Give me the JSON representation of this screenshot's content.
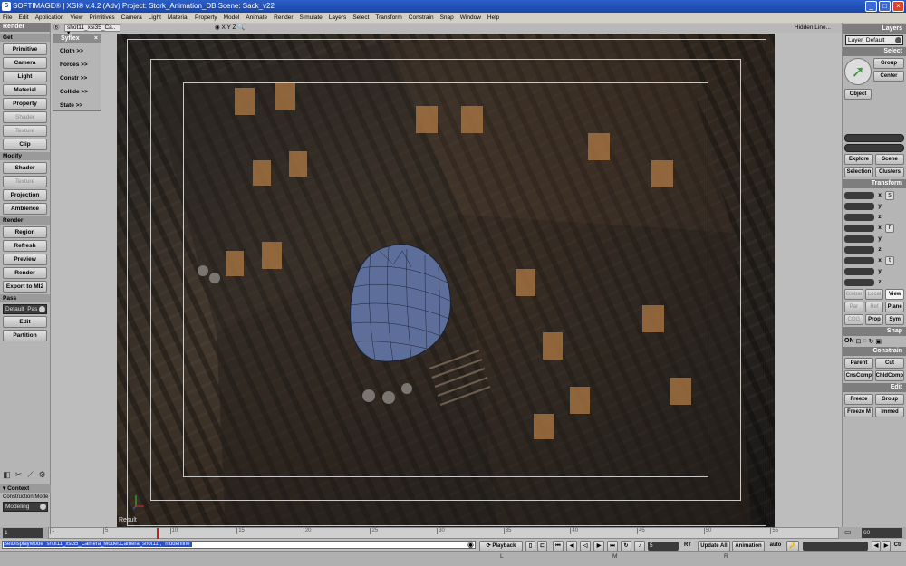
{
  "window": {
    "title": "SOFTIMAGE® | XSI® v.4.2 (Adv) Project: Stork_Animation_DB    Scene: Sack_v22",
    "app_icon": "xsi-icon"
  },
  "menu": [
    "File",
    "Edit",
    "Application",
    "View",
    "Primitives",
    "Camera",
    "Light",
    "Material",
    "Property",
    "Model",
    "Animate",
    "Render",
    "Simulate",
    "Layers",
    "Select",
    "Transform",
    "Constrain",
    "Snap",
    "Window",
    "Help"
  ],
  "left": {
    "header": "Render",
    "get_label": "Get",
    "get": [
      {
        "label": "Primitive",
        "enabled": true
      },
      {
        "label": "Camera",
        "enabled": true
      },
      {
        "label": "Light",
        "enabled": true
      },
      {
        "label": "Material",
        "enabled": true
      },
      {
        "label": "Property",
        "enabled": true
      },
      {
        "label": "Shader",
        "enabled": false
      },
      {
        "label": "Texture",
        "enabled": false
      },
      {
        "label": "Clip",
        "enabled": true
      }
    ],
    "modify_label": "Modify",
    "modify": [
      {
        "label": "Shader",
        "enabled": true
      },
      {
        "label": "Texture",
        "enabled": false
      },
      {
        "label": "Projection",
        "enabled": true
      },
      {
        "label": "Ambience",
        "enabled": true
      }
    ],
    "render_label": "Render",
    "render": [
      "Region",
      "Refresh",
      "Preview",
      "Render",
      "Export to MI2"
    ],
    "pass_label": "Pass",
    "pass_value": "Default_Pas",
    "pass_buttons": [
      "Edit",
      "Partition"
    ],
    "context_label": "Context",
    "construction_label": "Construction Mode",
    "construction_value": "Modeling"
  },
  "syflex": {
    "title": "Syflex",
    "items": [
      "Cloth  >>",
      "Forces  >>",
      "Constr  >>",
      "Collide  >>",
      "State  >>"
    ]
  },
  "viewport": {
    "camera_name": "shot11_xsi35_Ca..",
    "view_icons": "◉  X Y Z  🔍",
    "display_mode": "Hidden Line...",
    "label": "Result"
  },
  "right": {
    "layers_header": "Layers",
    "layer_value": "Layer_Default",
    "select_header": "Select",
    "select_buttons": [
      "Group",
      "Center"
    ],
    "object_label": "Object",
    "explore_buttons": [
      "Explore",
      "Scene"
    ],
    "selection_buttons": [
      "Selection",
      "Clusters"
    ],
    "transform_header": "Transform",
    "axes": [
      "x",
      "y",
      "z",
      "x",
      "y",
      "z",
      "x",
      "y",
      "z"
    ],
    "transform_icons": [
      "s",
      "r",
      "t"
    ],
    "space_buttons": [
      "Global",
      "Local",
      "View"
    ],
    "ref_buttons": [
      "Par",
      "Ref",
      "Plane"
    ],
    "cog_buttons": [
      "COG",
      "Prop",
      "Sym"
    ],
    "snap_header": "Snap",
    "snap_on": "ON",
    "constrain_header": "Constrain",
    "constrain_buttons": [
      "Parent",
      "Cut",
      "CnsComp",
      "ChldComp"
    ],
    "edit_header": "Edit",
    "edit_buttons": [
      "Freeze",
      "Group",
      "Freeze M",
      "Immed"
    ]
  },
  "timeline": {
    "start": "1",
    "end": "60",
    "ticks": [
      "1",
      "5",
      "10",
      "15",
      "20",
      "25",
      "30",
      "35",
      "40",
      "45",
      "50",
      "55"
    ],
    "current_frame": 9
  },
  "bottom": {
    "command": "SetDisplayMode \"shot11_xsi35_Camera_Model.Camera_shot11\", \"hiddenline\"",
    "playback": "Playback",
    "frame": "5",
    "rt": "RT",
    "update_all": "Update All",
    "animation": "Animation",
    "auto": "auto",
    "ctr": "Ctr",
    "keys": [
      "L",
      "M",
      "R"
    ]
  }
}
